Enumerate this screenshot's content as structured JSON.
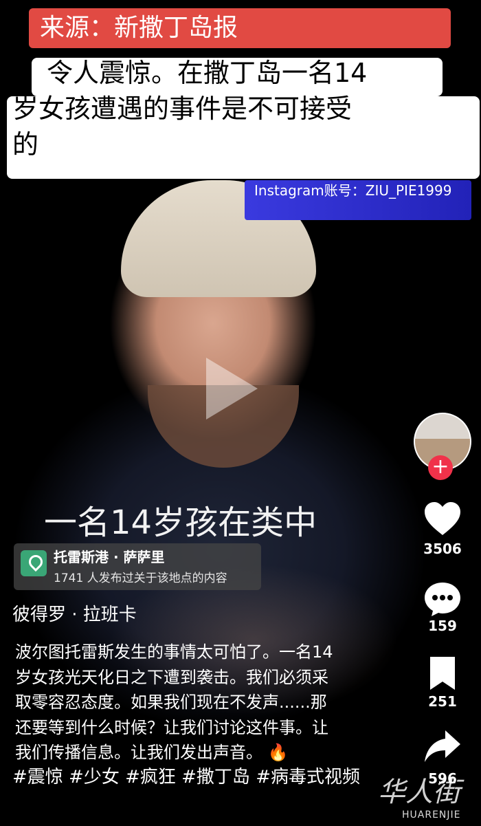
{
  "source_banner": {
    "text": "来源：新撒丁岛报"
  },
  "headline": {
    "text": "令人震惊。在撒丁岛一名14岁女孩遭遇的事件是不可接受的"
  },
  "instagram": {
    "text": "Instagram账号：ZIU_PIE1999"
  },
  "subtitle": {
    "text": "一名14岁孩在类中"
  },
  "location": {
    "title": "托雷斯港 · 萨萨里",
    "subtitle": "1741 人发布过关于该地点的内容"
  },
  "author": {
    "name": "彼得罗 · 拉班卡"
  },
  "description": {
    "lines": [
      "波尔图托雷斯发生的事情太可怕了。一名14",
      "岁女孩光天化日之下遭到袭击。我们必须采",
      "取零容忍态度。如果我们现在不发声......那",
      "还要等到什么时候？让我们讨论这件事。让",
      "我们传播信息。让我们发出声音。"
    ],
    "emoji": "🔥"
  },
  "hashtags": {
    "text": "#震惊 #少女 #疯狂 #撒丁岛 #病毒式视频"
  },
  "rail": {
    "follow_label": "+",
    "likes": "3506",
    "comments": "159",
    "bookmarks": "251",
    "shares": "596"
  },
  "watermark": {
    "cn": "华人街",
    "en": "HUARENJIE"
  },
  "colors": {
    "banner_red": "#e14a43",
    "follow_red": "#f0324a",
    "insta_blue": "#3a3adf"
  }
}
